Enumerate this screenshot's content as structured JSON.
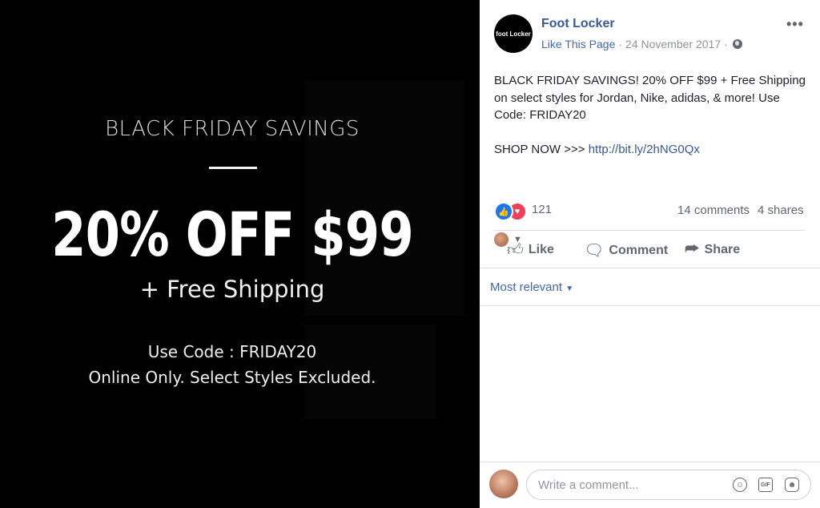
{
  "ad_image": {
    "title": "BLACK FRIDAY SAVINGS",
    "discount": "20% OFF $99",
    "shipping": "+ Free Shipping",
    "code_line": "Use Code : FRIDAY20",
    "online_line": "Online Only. Select Styles Excluded."
  },
  "post": {
    "page_name": "Foot Locker",
    "avatar_text": "foot Locker",
    "like_page": "Like This Page",
    "date": "24 November 2017",
    "text": "BLACK FRIDAY SAVINGS! 20% OFF $99 + Free Shipping on select styles for Jordan, Nike, adidas, & more! Use Code: FRIDAY20",
    "shop_prefix": "SHOP NOW >>>",
    "link": "http://bit.ly/2hNG0Qx"
  },
  "stats": {
    "reactions": "121",
    "comments": "14 comments",
    "shares": "4 shares"
  },
  "actions": {
    "like": "Like",
    "comment": "Comment",
    "share": "Share"
  },
  "sort": {
    "label": "Most relevant"
  },
  "composer": {
    "placeholder": "Write a comment..."
  },
  "icons": {
    "more": "more-options-icon",
    "globe": "globe-icon",
    "like_reaction": "thumbs-up-icon",
    "love_reaction": "heart-icon",
    "emoji": "emoji-icon",
    "gif": "gif-icon",
    "sticker": "sticker-icon"
  },
  "colors": {
    "link": "#385898",
    "like_blue": "#1877f2",
    "love_red": "#f33e58",
    "meta_gray": "#90949c"
  }
}
